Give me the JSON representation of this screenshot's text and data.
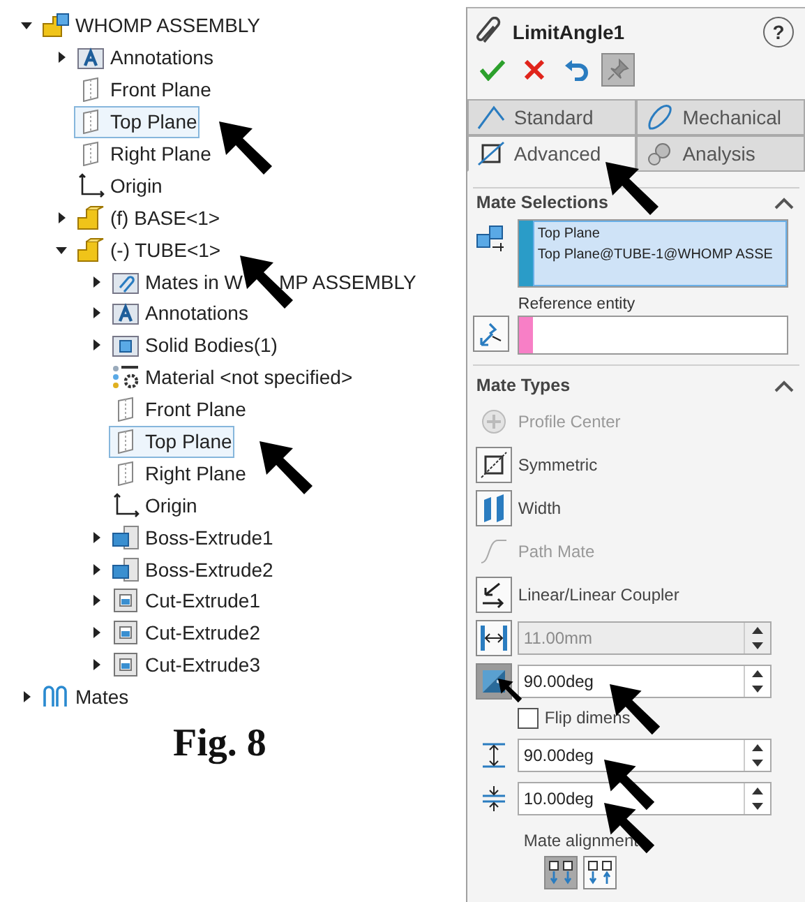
{
  "tree": [
    {
      "label": "WHOMP ASSEMBLY",
      "kind": "assembly",
      "expanded": true,
      "selected": false,
      "children": [
        {
          "label": "Annotations",
          "kind": "annotations",
          "expanded": false,
          "selected": false
        },
        {
          "label": "Front Plane",
          "kind": "plane",
          "selected": false
        },
        {
          "label": "Top Plane",
          "kind": "plane",
          "selected": true
        },
        {
          "label": "Right Plane",
          "kind": "plane",
          "selected": false
        },
        {
          "label": "Origin",
          "kind": "origin",
          "selected": false
        },
        {
          "label": "(f) BASE<1>",
          "kind": "part",
          "expanded": false,
          "selected": false
        },
        {
          "label": "(-) TUBE<1>",
          "kind": "part",
          "expanded": true,
          "selected": false,
          "children": [
            {
              "label": "Mates in W",
              "label_tail": "MP ASSEMBLY",
              "kind": "mates_folder",
              "expanded": false,
              "selected": false
            },
            {
              "label": "Annotations",
              "kind": "annotations",
              "expanded": false,
              "selected": false
            },
            {
              "label": "Solid Bodies(1)",
              "kind": "solid_bodies",
              "expanded": false,
              "selected": false
            },
            {
              "label": "Material <not specified>",
              "kind": "material",
              "selected": false
            },
            {
              "label": "Front Plane",
              "kind": "plane",
              "selected": false
            },
            {
              "label": "Top Plane",
              "kind": "plane",
              "selected": true
            },
            {
              "label": "Right Plane",
              "kind": "plane",
              "selected": false
            },
            {
              "label": "Origin",
              "kind": "origin",
              "selected": false
            },
            {
              "label": "Boss-Extrude1",
              "kind": "boss",
              "expanded": false,
              "selected": false
            },
            {
              "label": "Boss-Extrude2",
              "kind": "boss",
              "expanded": false,
              "selected": false
            },
            {
              "label": "Cut-Extrude1",
              "kind": "cut",
              "expanded": false,
              "selected": false
            },
            {
              "label": "Cut-Extrude2",
              "kind": "cut",
              "expanded": false,
              "selected": false
            },
            {
              "label": "Cut-Extrude3",
              "kind": "cut",
              "expanded": false,
              "selected": false
            }
          ]
        }
      ]
    },
    {
      "label": "Mates",
      "kind": "mates",
      "expanded": false,
      "selected": false
    }
  ],
  "figure_caption": "Fig. 8",
  "property_panel": {
    "title": "LimitAngle1",
    "help": "?",
    "actions": [
      {
        "kind": "ok",
        "pressed": false
      },
      {
        "kind": "cancel",
        "pressed": false
      },
      {
        "kind": "undo",
        "pressed": false
      },
      {
        "kind": "pin",
        "pressed": true
      }
    ],
    "tabs": [
      {
        "label": "Standard",
        "kind": "standard",
        "selected": false
      },
      {
        "label": "Mechanical",
        "kind": "mechanical",
        "selected": false
      },
      {
        "label": "Advanced",
        "kind": "advanced",
        "selected": true
      },
      {
        "label": "Analysis",
        "kind": "analysis",
        "selected": false
      }
    ],
    "mate_selections": {
      "title": "Mate Selections",
      "expanded": true,
      "entities": [
        "Top Plane",
        "Top Plane@TUBE-1@WHOMP ASSE"
      ],
      "reference_label": "Reference entity"
    },
    "mate_types": {
      "title": "Mate Types",
      "expanded": true,
      "types": [
        {
          "label": "Profile Center",
          "kind": "profile",
          "disabled": true
        },
        {
          "label": "Symmetric",
          "kind": "symmetric",
          "disabled": false
        },
        {
          "label": "Width",
          "kind": "width",
          "disabled": false
        },
        {
          "label": "Path Mate",
          "kind": "path",
          "disabled": true
        },
        {
          "label": "Linear/Linear Coupler",
          "kind": "linear",
          "disabled": false
        }
      ],
      "fields": [
        {
          "kind": "distance",
          "value": "11.00mm",
          "disabled": true,
          "pressed": false
        },
        {
          "kind": "angle",
          "value": "90.00deg",
          "disabled": false,
          "pressed": true
        },
        {
          "kind": "flip",
          "label": "Flip dimens",
          "checked": false
        },
        {
          "kind": "max",
          "value": "90.00deg",
          "disabled": false,
          "pressed": false
        },
        {
          "kind": "min",
          "value": "10.00deg",
          "disabled": false,
          "pressed": false
        }
      ],
      "alignment": {
        "label": "Mate alignment",
        "options": [
          {
            "kind": "aligned",
            "selected": true
          },
          {
            "kind": "anti",
            "selected": false
          }
        ]
      }
    }
  }
}
